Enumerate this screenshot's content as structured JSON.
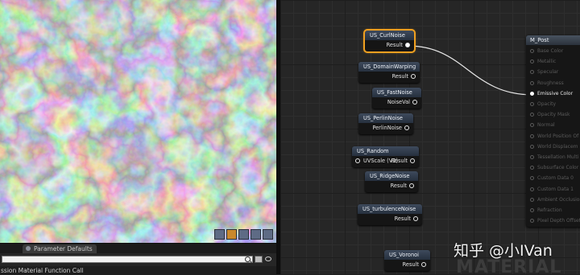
{
  "viewport": {
    "icons": [
      "view-mode-icon",
      "material-sphere-icon",
      "cylinder-icon",
      "plane-icon",
      "cube-icon"
    ]
  },
  "bottom_panel": {
    "tab_label": "Parameter Defaults",
    "list_item": "ssion Material Function Call"
  },
  "graph": {
    "nodes": [
      {
        "title": "US_CurlNoise",
        "output": "Result"
      },
      {
        "title": "US_DomainWarping",
        "output": "Result"
      },
      {
        "title": "US_FastNoise",
        "output": "NoiseVal"
      },
      {
        "title": "US_PerlinNoise",
        "output": "PerlinNoise"
      },
      {
        "title": "US_Random",
        "input": "UVScale (V2)",
        "output": "Result"
      },
      {
        "title": "US_RidgeNoise",
        "output": "Result"
      },
      {
        "title": "US_turbulenceNoise",
        "output": "Result"
      },
      {
        "title": "US_Voronoi",
        "output": "Result"
      }
    ],
    "material": {
      "title": "M_Post",
      "inputs": [
        "Base Color",
        "Metallic",
        "Specular",
        "Roughness",
        "Emissive Color",
        "Opacity",
        "Opacity Mask",
        "Normal",
        "World Position Of",
        "World Displacem",
        "Tessellation Multi",
        "Subsurface Color",
        "Custom Data 0",
        "Custom Data 1",
        "Ambient Occlusion",
        "Refraction",
        "Pixel Depth Offset"
      ]
    },
    "watermark": "MATERIAL"
  },
  "overlay": {
    "zhihu_text": "知乎 @小IVan"
  }
}
